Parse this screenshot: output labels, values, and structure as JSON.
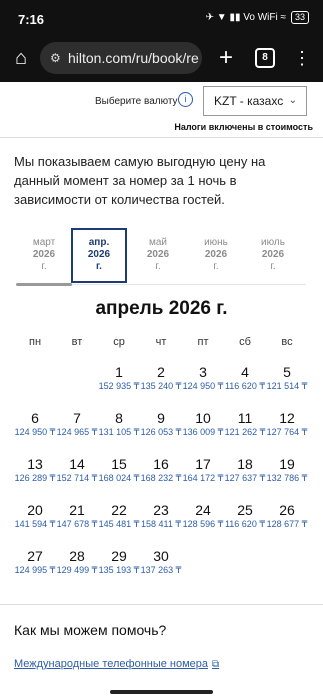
{
  "status": {
    "time": "7:16",
    "indicators": "✈ ▼ ▮▮ Vo WiFi ≈",
    "battery": "33"
  },
  "browser": {
    "url": "hilton.com/ru/book/re",
    "tab_count": "8"
  },
  "currency": {
    "label": "Выберите валюту",
    "selected": "KZT - казахс",
    "tax_note": "Налоги включены в стоимость"
  },
  "intro": "Мы показываем самую выгодную цену на данный момент за номер за 1 ночь в зависимости от количества гостей.",
  "months": [
    {
      "name": "март",
      "year": "2026",
      "suffix": "г."
    },
    {
      "name": "апр.",
      "year": "2026",
      "suffix": "г."
    },
    {
      "name": "май",
      "year": "2026",
      "suffix": "г."
    },
    {
      "name": "июнь",
      "year": "2026",
      "suffix": "г."
    },
    {
      "name": "июль",
      "year": "2026",
      "suffix": "г."
    }
  ],
  "calendar": {
    "title": "апрель 2026 г.",
    "weekdays": [
      "пн",
      "вт",
      "ср",
      "чт",
      "пт",
      "сб",
      "вс"
    ],
    "days": [
      {
        "n": "1",
        "p": "152 935 ₸"
      },
      {
        "n": "2",
        "p": "135 240 ₸"
      },
      {
        "n": "3",
        "p": "124 950 ₸"
      },
      {
        "n": "4",
        "p": "116 620 ₸"
      },
      {
        "n": "5",
        "p": "121 514 ₸"
      },
      {
        "n": "6",
        "p": "124 950 ₸"
      },
      {
        "n": "7",
        "p": "124 965 ₸"
      },
      {
        "n": "8",
        "p": "131 105 ₸"
      },
      {
        "n": "9",
        "p": "126 053 ₸"
      },
      {
        "n": "10",
        "p": "136 009 ₸"
      },
      {
        "n": "11",
        "p": "121 262 ₸"
      },
      {
        "n": "12",
        "p": "127 764 ₸"
      },
      {
        "n": "13",
        "p": "126 289 ₸"
      },
      {
        "n": "14",
        "p": "152 714 ₸"
      },
      {
        "n": "15",
        "p": "168 024 ₸"
      },
      {
        "n": "16",
        "p": "168 232 ₸"
      },
      {
        "n": "17",
        "p": "164 172 ₸"
      },
      {
        "n": "18",
        "p": "127 637 ₸"
      },
      {
        "n": "19",
        "p": "132 786 ₸"
      },
      {
        "n": "20",
        "p": "141 594 ₸"
      },
      {
        "n": "21",
        "p": "147 678 ₸"
      },
      {
        "n": "22",
        "p": "145 481 ₸"
      },
      {
        "n": "23",
        "p": "158 411 ₸"
      },
      {
        "n": "24",
        "p": "128 596 ₸"
      },
      {
        "n": "25",
        "p": "116 620 ₸"
      },
      {
        "n": "26",
        "p": "128 677 ₸"
      },
      {
        "n": "27",
        "p": "124 995 ₸"
      },
      {
        "n": "28",
        "p": "129 499 ₸"
      },
      {
        "n": "29",
        "p": "135 193 ₸"
      },
      {
        "n": "30",
        "p": "137 263 ₸"
      }
    ]
  },
  "help": {
    "title": "Как мы можем помочь?",
    "link": "Международные телефонные номера"
  }
}
